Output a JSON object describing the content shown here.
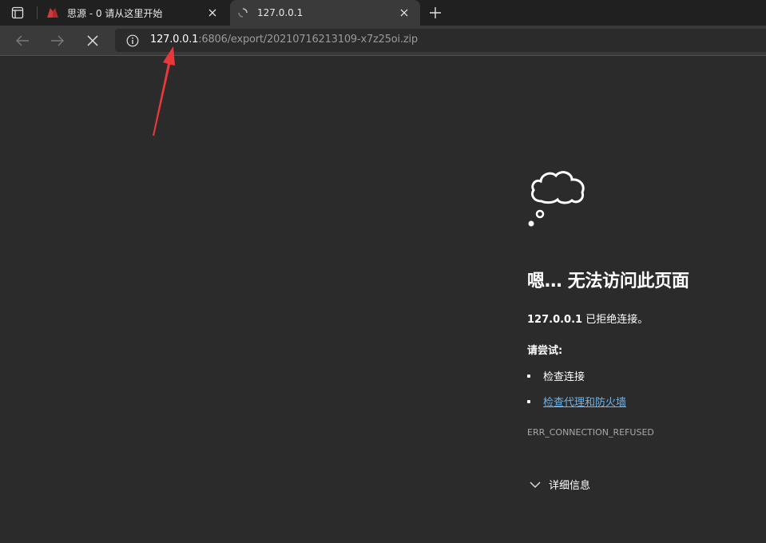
{
  "tabs": [
    {
      "title": "思源 - 0 请从这里开始",
      "favicon": "siyuan-logo-icon",
      "active": false
    },
    {
      "title": "127.0.0.1",
      "favicon": "loading-icon",
      "active": true
    }
  ],
  "address": {
    "host": "127.0.0.1",
    "rest": ":6806/export/20210716213109-x7z25oi.zip"
  },
  "error": {
    "heading": "嗯… 无法访问此页面",
    "host": "127.0.0.1",
    "message": " 已拒绝连接。",
    "try_label": "请尝试:",
    "suggestions": [
      "检查连接",
      "检查代理和防火墙"
    ],
    "code": "ERR_CONNECTION_REFUSED",
    "details_label": "详细信息"
  },
  "colors": {
    "background": "#2b2b2b",
    "link": "#6cb4ee",
    "annotation": "#e8383c"
  }
}
